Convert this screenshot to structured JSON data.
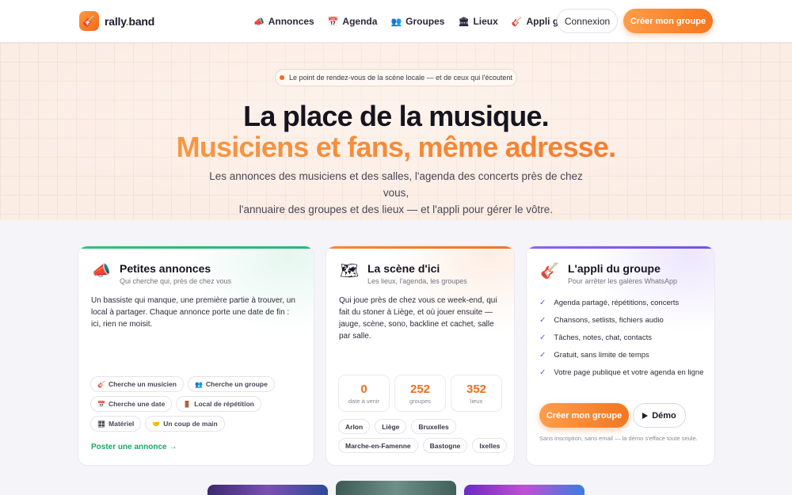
{
  "brand": {
    "name_main": "rally",
    "name_dot": ".",
    "name_tail": "band"
  },
  "nav": {
    "links": [
      {
        "icon": "📣",
        "label": "Annonces"
      },
      {
        "icon": "📅",
        "label": "Agenda"
      },
      {
        "icon": "👥",
        "label": "Groupes"
      },
      {
        "icon": "🏛",
        "label": "Lieux"
      },
      {
        "icon": "🎸",
        "label": "Appli groupe"
      }
    ],
    "login": "Connexion",
    "cta": "Créer mon groupe"
  },
  "hero": {
    "pill": "Le point de rendez-vous de la scène locale — et de ceux qui l'écoutent",
    "title_line1": "La place de la musique.",
    "title_line2": "Musiciens et fans, même adresse.",
    "subtitle_line1": "Les annonces des musiciens et des salles, l'agenda des concerts près de chez vous,",
    "subtitle_line2": "l'annuaire des groupes et des lieux — et l'appli pour gérer le vôtre."
  },
  "cards": {
    "annonces": {
      "icon": "📣",
      "title": "Petites annonces",
      "subtitle": "Qui cherche qui, près de chez vous",
      "text": "Un bassiste qui manque, une première partie à trouver, un local à partager. Chaque annonce porte une date de fin : ici, rien ne moisit.",
      "chips": [
        {
          "icon": "🎸",
          "label": "Cherche un musicien"
        },
        {
          "icon": "👥",
          "label": "Cherche un groupe"
        },
        {
          "icon": "📅",
          "label": "Cherche une date"
        },
        {
          "icon": "🚪",
          "label": "Local de répétition"
        },
        {
          "icon": "🎛",
          "label": "Matériel"
        },
        {
          "icon": "🤝",
          "label": "Un coup de main"
        }
      ],
      "link": "Poster une annonce →"
    },
    "scene": {
      "icon": "🗺",
      "title": "La scène d'ici",
      "subtitle": "Les lieux, l'agenda, les groupes",
      "text": "Qui joue près de chez vous ce week-end, qui fait du stoner à Liège, et où jouer ensuite — jauge, scène, sono, backline et cachet, salle par salle.",
      "stats": [
        {
          "value": "0",
          "label": "date à venir"
        },
        {
          "value": "252",
          "label": "groupes"
        },
        {
          "value": "352",
          "label": "lieux"
        }
      ],
      "cities": [
        "Arlon",
        "Liège",
        "Bruxelles",
        "Marche-en-Famenne",
        "Bastogne",
        "Ixelles"
      ]
    },
    "appli": {
      "icon": "🎸",
      "title": "L'appli du groupe",
      "subtitle": "Pour arrêter les galères WhatsApp",
      "features": [
        "Agenda partagé, répétitions, concerts",
        "Chansons, setlists, fichiers audio",
        "Tâches, notes, chat, contacts",
        "Gratuit, sans limite de temps",
        "Votre page publique et votre agenda en ligne"
      ],
      "check": "✓",
      "cta": "Créer mon groupe",
      "demo": "Démo",
      "note": "Sans inscription, sans email — la démo s'efface toute seule."
    }
  },
  "colors": {
    "accent": "#f4761f",
    "green": "#1ea660",
    "purple": "#6b55e0"
  }
}
